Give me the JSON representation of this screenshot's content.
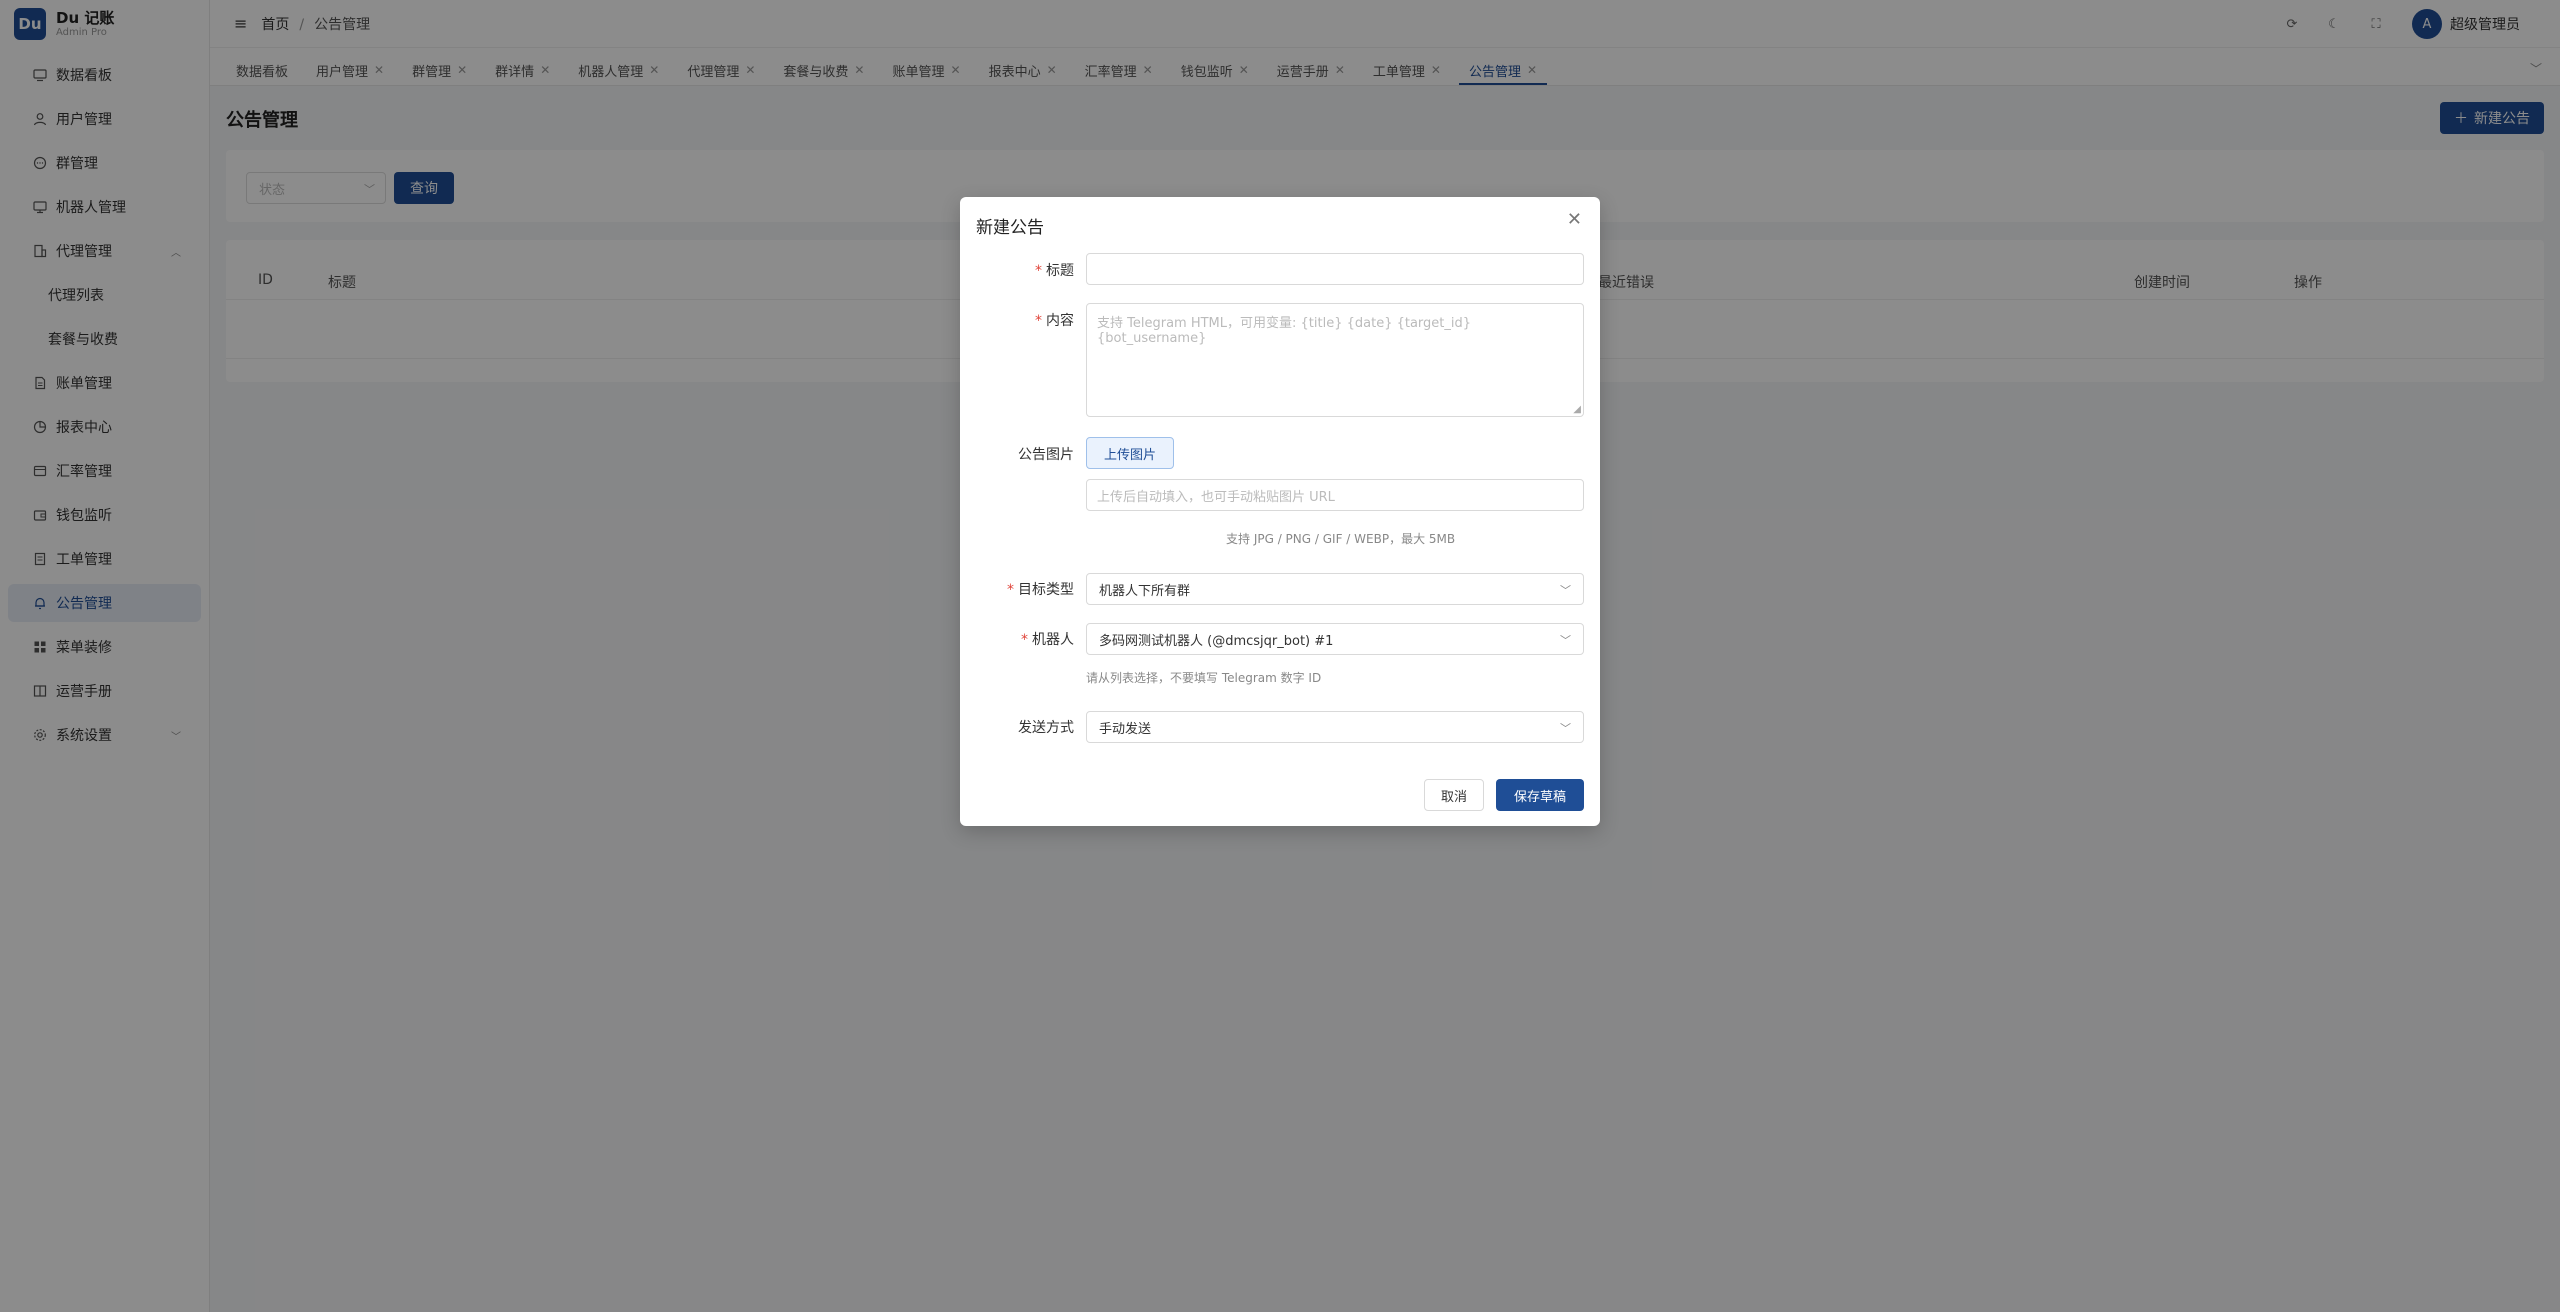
{
  "brand": {
    "name": "Du 记账",
    "sub": "Admin Pro",
    "logo": "Du"
  },
  "sidebar": {
    "items": [
      {
        "label": "数据看板",
        "icon": "dashboard-icon"
      },
      {
        "label": "用户管理",
        "icon": "user-icon"
      },
      {
        "label": "群管理",
        "icon": "chat-icon"
      },
      {
        "label": "机器人管理",
        "icon": "monitor-icon"
      },
      {
        "label": "代理管理",
        "icon": "building-icon"
      },
      {
        "label": "代理列表"
      },
      {
        "label": "套餐与收费"
      },
      {
        "label": "账单管理",
        "icon": "file-icon"
      },
      {
        "label": "报表中心",
        "icon": "pie-icon"
      },
      {
        "label": "汇率管理",
        "icon": "exchange-icon"
      },
      {
        "label": "钱包监听",
        "icon": "wallet-icon"
      },
      {
        "label": "工单管理",
        "icon": "ticket-icon"
      },
      {
        "label": "公告管理",
        "icon": "bell-icon"
      },
      {
        "label": "菜单装修",
        "icon": "grid-icon"
      },
      {
        "label": "运营手册",
        "icon": "book-icon"
      },
      {
        "label": "系统设置",
        "icon": "gear-icon"
      }
    ]
  },
  "header": {
    "home": "首页",
    "current": "公告管理",
    "user": "超级管理员",
    "avatar": "A"
  },
  "tabs": [
    "数据看板",
    "用户管理",
    "群管理",
    "群详情",
    "机器人管理",
    "代理管理",
    "套餐与收费",
    "账单管理",
    "报表中心",
    "汇率管理",
    "钱包监听",
    "运营手册",
    "工单管理",
    "公告管理"
  ],
  "page": {
    "title": "公告管理",
    "new_button": "新建公告",
    "filter": {
      "status_placeholder": "状态",
      "query": "查询"
    },
    "table_headers": {
      "id": "ID",
      "title": "标题",
      "error": "最近错误",
      "created": "创建时间",
      "ops": "操作"
    }
  },
  "modal": {
    "title": "新建公告",
    "title_label": "标题",
    "content_label": "内容",
    "content_placeholder": "支持 Telegram HTML，可用变量: {title} {date} {target_id} {bot_username}",
    "image_label": "公告图片",
    "upload_button": "上传图片",
    "image_url_placeholder": "上传后自动填入，也可手动粘贴图片 URL",
    "image_hint": "支持 JPG / PNG / GIF / WEBP，最大 5MB",
    "target_type_label": "目标类型",
    "target_type_value": "机器人下所有群",
    "bot_label": "机器人",
    "bot_value": "多码网测试机器人 (@dmcsjqr_bot) #1",
    "bot_hint": "请从列表选择，不要填写 Telegram 数字 ID",
    "send_mode_label": "发送方式",
    "send_mode_value": "手动发送",
    "cancel": "取消",
    "save": "保存草稿"
  },
  "colors": {
    "primary": "#1f4e96",
    "required": "#e0443a"
  }
}
